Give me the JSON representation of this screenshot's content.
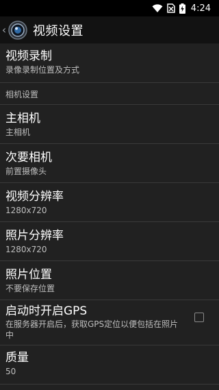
{
  "status_bar": {
    "time": "4:24",
    "icons": [
      "wifi-icon",
      "no-sim-icon",
      "battery-charging-icon"
    ]
  },
  "app_bar": {
    "back_icon": "chevron-left-icon",
    "app_icon": "camera-lens-icon",
    "title": "视频设置"
  },
  "preferences": {
    "video_recording": {
      "title": "视频录制",
      "summary": "录像录制位置及方式"
    },
    "camera_section_header": "相机设置",
    "main_camera": {
      "title": "主相机",
      "summary": "主相机"
    },
    "secondary_camera": {
      "title": "次要相机",
      "summary": "前置摄像头"
    },
    "video_resolution": {
      "title": "视频分辨率",
      "summary": "1280x720"
    },
    "photo_resolution": {
      "title": "照片分辨率",
      "summary": "1280x720"
    },
    "photo_location": {
      "title": "照片位置",
      "summary": "不要保存位置"
    },
    "gps_on_start": {
      "title": "启动时开启GPS",
      "summary": "在服务器开启后，获取GPS定位以便包括在照片中",
      "checked": false
    },
    "quality": {
      "title": "质量",
      "summary": "50"
    }
  },
  "colors": {
    "background": "#212121",
    "status_bar": "#000000",
    "app_bar": "#121212",
    "divider": "#3a3a3a",
    "title_text": "#ffffff",
    "summary_text": "#bfbfbf"
  }
}
